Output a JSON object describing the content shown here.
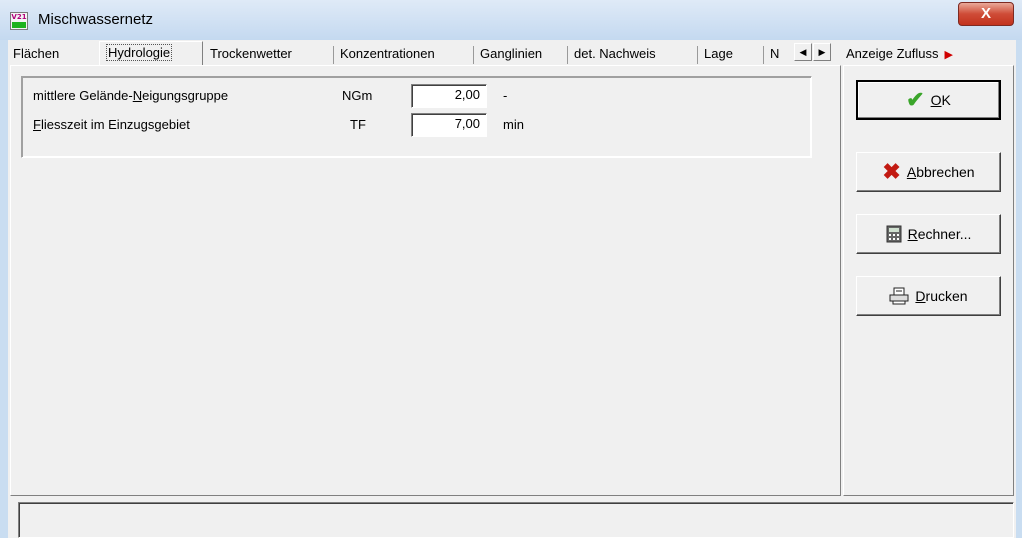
{
  "window": {
    "title": "Mischwassernetz",
    "close_label": "X",
    "icon_text": "V21"
  },
  "tabs": [
    {
      "label": "Flächen"
    },
    {
      "label": "Hydrologie"
    },
    {
      "label": "Trockenwetter"
    },
    {
      "label": "Konzentrationen"
    },
    {
      "label": "Ganglinien"
    },
    {
      "label": "det. Nachweis"
    },
    {
      "label": "Lage"
    },
    {
      "label": "N"
    }
  ],
  "active_tab": "Hydrologie",
  "right_tab": {
    "label": "Anzeige Zufluss"
  },
  "form": {
    "row1": {
      "label_pre": "mittlere Gelände-",
      "label_u": "N",
      "label_post": "eigungsgruppe",
      "symbol": "NGm",
      "value": "2,00",
      "unit": "-"
    },
    "row2": {
      "label_u": "F",
      "label_post": "liesszeit im Einzugsgebiet",
      "symbol": "TF",
      "value": "7,00",
      "unit": "min"
    }
  },
  "buttons": {
    "ok": {
      "u": "O",
      "rest": "K"
    },
    "cancel": {
      "u": "A",
      "rest": "bbrechen"
    },
    "calc": {
      "u": "R",
      "rest": "echner..."
    },
    "print": {
      "u": "D",
      "rest": "rucken"
    }
  },
  "colors": {
    "ok_icon": "#3aa52a",
    "cancel_icon": "#c21a12",
    "close_button": "#c94a36"
  },
  "status_text": ""
}
